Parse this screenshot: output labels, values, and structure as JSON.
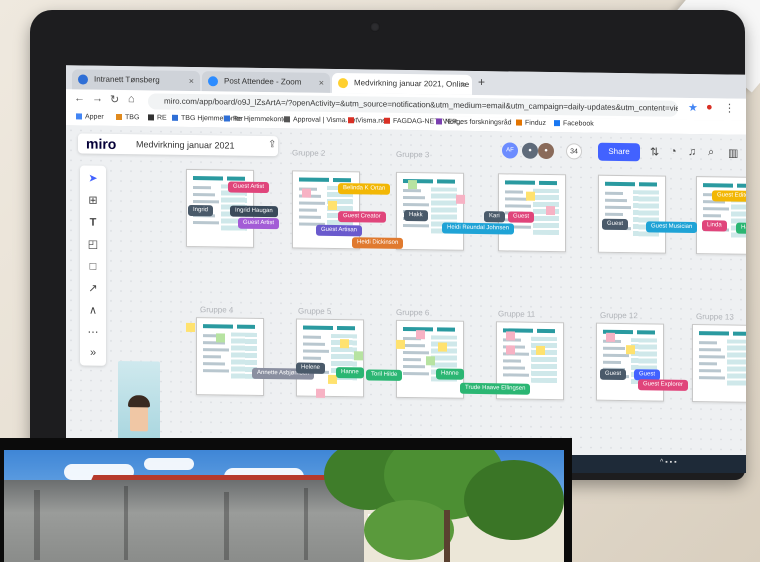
{
  "browser": {
    "tabs": [
      {
        "label": "Intranett Tønsberg",
        "color": "#2f6fd6"
      },
      {
        "label": "Post Attendee - Zoom",
        "color": "#2d8cff"
      },
      {
        "label": "Medvirkning januar 2021, Online",
        "color": "#ffd02f"
      }
    ],
    "new_tab": "+",
    "url": "miro.com/app/board/o9J_lZsArtA=/?openActivity=&utm_source=notification&utm_medium=email&utm_campaign=daily-updates&utm_content=view",
    "bookmarks": [
      "Apper",
      "TBG",
      "RE",
      "TBG Hjemmekontor",
      "Re Hjemmekontor",
      "Approval | Visma.net",
      "Visma.net",
      "FAGDAG-NETTVER...",
      "Norges forskningsråd",
      "Finduz",
      "Facebook"
    ],
    "bookmark_colors": [
      "#4285f4",
      "#e08a1e",
      "#333333",
      "#2f6fd6",
      "#2f6fd6",
      "#555555",
      "#d93025",
      "#d93025",
      "#7a3fb0",
      "#e37400",
      "#1877f2"
    ]
  },
  "miro": {
    "logo": "miro",
    "board_title": "Medvirkning januar 2021",
    "share_label": "Share",
    "participant_count": "34",
    "frames": [
      "Gruppe 2",
      "Gruppe 3",
      "Gruppe 4",
      "Gruppe 5",
      "Gruppe 6",
      "Gruppe 11",
      "Gruppe 12",
      "Gruppe 13"
    ],
    "cursors": [
      {
        "label": "Guest Artist",
        "color": "#e0457b"
      },
      {
        "label": "Belinda K Ortan",
        "color": "#f2b705"
      },
      {
        "label": "Ingrid",
        "color": "#4a5a6a"
      },
      {
        "label": "Ingrid Haugan",
        "color": "#3a4a5a"
      },
      {
        "label": "Guest Artist",
        "color": "#a35cd6"
      },
      {
        "label": "Guest Creator",
        "color": "#e0457b"
      },
      {
        "label": "Guest Artisan",
        "color": "#6a5acd"
      },
      {
        "label": "Heidi Dickinson",
        "color": "#e07a2f"
      },
      {
        "label": "Hakk",
        "color": "#4a5a6a"
      },
      {
        "label": "Heidi Reundal Johnsen",
        "color": "#1fa3d6"
      },
      {
        "label": "Kari",
        "color": "#4a5a6a"
      },
      {
        "label": "Guest",
        "color": "#e0457b"
      },
      {
        "label": "Guest",
        "color": "#4a5a6a"
      },
      {
        "label": "Guest Musician",
        "color": "#1fa3d6"
      },
      {
        "label": "Guest Editor",
        "color": "#f2b705"
      },
      {
        "label": "Linda",
        "color": "#e0457b"
      },
      {
        "label": "Hanne",
        "color": "#2bb673"
      },
      {
        "label": "Annette Asbjørnsen",
        "color": "#8a8fa0"
      },
      {
        "label": "Helene",
        "color": "#4a5a6a"
      },
      {
        "label": "Hanne",
        "color": "#2bb673"
      },
      {
        "label": "Toril Hilde",
        "color": "#2bb673"
      },
      {
        "label": "Hanne",
        "color": "#2bb673"
      },
      {
        "label": "Trude Haave Ellingsen",
        "color": "#2bb673"
      },
      {
        "label": "Guest",
        "color": "#4a5a6a"
      },
      {
        "label": "Guest",
        "color": "#4262ff"
      },
      {
        "label": "Guest Explorer",
        "color": "#e0457b"
      }
    ]
  }
}
